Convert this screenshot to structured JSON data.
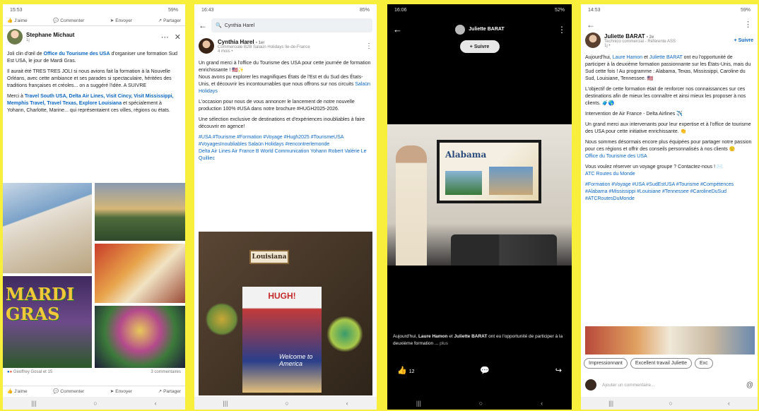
{
  "phone1": {
    "status_time": "15:53",
    "status_right": "59%",
    "top_actions": [
      "J'aime",
      "Commenter",
      "Envoyer",
      "Partager"
    ],
    "author": "Stephane Michaut",
    "author_meta": "1j",
    "p1": [
      "Joli clin d'œil de ",
      "Office du Tourisme des USA",
      " d'organiser une formation Sud Est USA, le jour de Mardi Gras."
    ],
    "p2": "Il aurait été TRES TRES JOLI si nous avions fait la formation à la Nouvelle Orléans, avec cette ambiance et ses parades si spectaculaire, héritées des traditions françaises et créoles... on a suggéré l'idée. A SUIVRE",
    "p3_prefix": "Merci à ",
    "p3_links": "Travel South USA, Delta Air Lines, Visit Cincy, Visit Mississippi, Memphis Travel, Travel Texas, Explore Louisiana",
    "p3_suffix": " et spécialement à Yohann, Charlotte, Marine... qui représentaient ces villes, régions ou états.",
    "photo_text": "MARDI GRAS",
    "reactions": "Geoffrey Gosal et 15",
    "comments_count": "3 commentaires",
    "bottom_actions": [
      "J'aime",
      "Commenter",
      "Envoyer",
      "Partager"
    ]
  },
  "phone2": {
    "status_time": "16:43",
    "status_right": "85%",
    "search_value": "Cynthia Harel",
    "author": "Cynthia Harel",
    "author_degree": "• 1er",
    "author_title": "Commerciale B2B Salaün Holidays Ile-de-France",
    "author_meta": "4 mois •",
    "p1": "Un grand merci à l'office du Tourisme des USA pour cette journée de formation enrichissante ! 🇺🇸✨",
    "p2": "Nous avons pu explorer les magnifiques États de l'Est et du Sud des États-Unis, et découvrir les incontournables que nous offrons sur nos circuits ",
    "p2_link": "Salaün Holidays",
    "p3": "L'occasion pour nous de vous annoncer le lancement de notre nouvelle production 100% #USA dans notre brochure #HUGH2025-2026.",
    "p4": "Une sélection exclusive de destinations et d'expériences inoubliables à faire découvrir en agence!",
    "hashtags": "#USA #Tourisme #Formation #Voyage #Hugh2025 #TourismeUSA #VoyagesInoubliables Salaün Holidays #rencontrerlemonde",
    "mentions": "Delta Air Lines Air France B World Communication Yohann Robert Valérie Le Quilliec",
    "photo_sign": "Louisiana",
    "photo_brochure": "HUGH!",
    "photo_brochure_sub": "Welcome to America"
  },
  "phone3": {
    "status_time": "16:06",
    "status_right": "52%",
    "author": "Juliette BARAT",
    "follow_label": "+ Suivre",
    "slide_title": "Alabama",
    "caption_prefix": "Aujourd'hui, ",
    "caption_name1": "Laure Hamon",
    "caption_mid": " et ",
    "caption_name2": "Juliette BARAT",
    "caption_suffix": " ont eu l'opportunité de participer à la deuxième formation ... ",
    "caption_more": "plus",
    "likes": "12"
  },
  "phone4": {
    "status_time": "14:53",
    "status_right": "59%",
    "author": "Juliette BARAT",
    "author_degree": "• 2e",
    "author_title": "Technico commercial - Référente ASS",
    "author_meta": "1j •",
    "follow_label": "+ Suivre",
    "p1_prefix": "Aujourd'hui, ",
    "p1_name1": "Laure Hamon",
    "p1_mid": " et ",
    "p1_name2": "Juliette BARAT",
    "p1_suffix": " ont eu l'opportunité de participer à la deuxième formation passionnante sur les États-Unis, mais du Sud cette fois ! Au programme : Alabama, Texas, Mississippi, Caroline du Sud, Louisiane, Tennessee. 🇺🇸",
    "p2": "L'objectif de cette formation était de renforcer nos connaissances sur ces destinations afin de mieux les connaître et ainsi mieux les proposer à nos clients. 🧳🌎",
    "p3": "Intervention de Air France - Delta Airlines ✈️",
    "p4": "Un grand merci aux intervenants pour leur expertise et à l'office de tourisme des USA pour cette initiative enrichissante. 👏",
    "p5": "Nous sommes désormais encore plus équipées pour partager notre passion pour ces régions et offrir des conseils personnalisés à nos clients 🙂",
    "p5_link": "Office du Tourisme des USA",
    "p6": "Vous voulez réserver un voyage groupe ? Contactez-nous ! ✉️",
    "p6_link": "ATC Routes du Monde",
    "hashtags": "#Formation #Voyage #USA #SudEstUSA #Tourisme #Compétences #Alabama #Mississippi #Louisiane #Tennessee #CarolineDuSud #ATCRoutesDuMonde",
    "chips": [
      "Impressionnant",
      "Excellent travail Juliette",
      "Exc"
    ],
    "comment_placeholder": "Ajouter un commentaire..."
  },
  "nav": [
    "|||",
    "○",
    "‹"
  ],
  "colors": {
    "background": "#f7ef3c",
    "link": "#0a66c2"
  }
}
